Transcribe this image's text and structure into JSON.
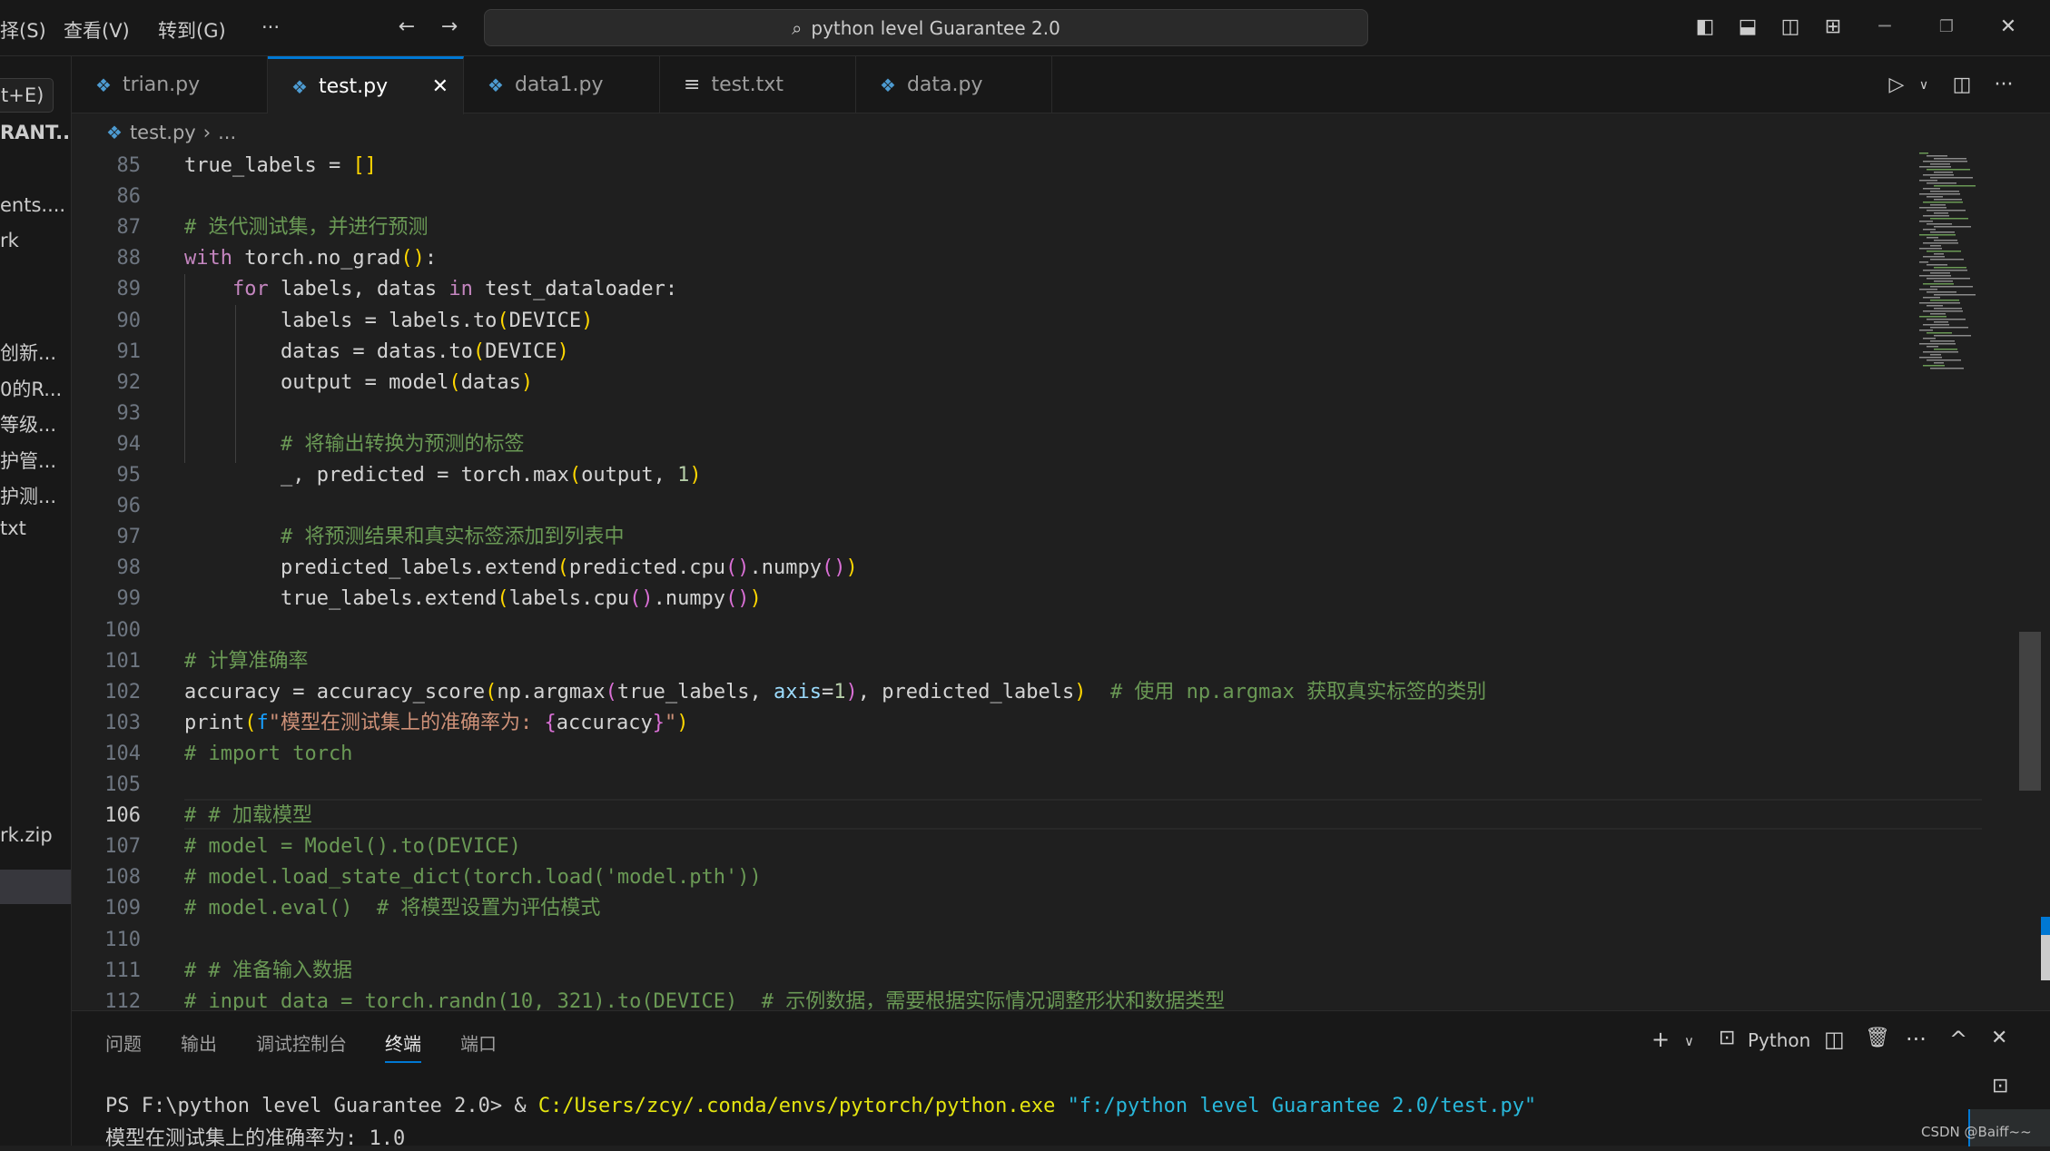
{
  "titlebar": {
    "menus": [
      "择(S)",
      "查看(V)",
      "转到(G)",
      "···"
    ],
    "search_text": "python level Guarantee 2.0",
    "icons": [
      "arrow-left-icon",
      "arrow-right-icon",
      "toggle-sidebar-icon",
      "toggle-panel-icon",
      "toggle-secondary-sidebar-icon",
      "customize-layout-icon",
      "minimize-icon",
      "restore-icon",
      "close-icon"
    ]
  },
  "sidebar": {
    "button_label": "t+E)",
    "header": "RANT...",
    "items": [
      "ents....",
      "rk",
      "创新...",
      "0的R...",
      "等级...",
      "护管...",
      "护测...",
      "txt",
      "rk.zip"
    ]
  },
  "tabs": [
    {
      "label": "trian.py",
      "icon": "python-icon"
    },
    {
      "label": "test.py",
      "icon": "python-icon",
      "active": true
    },
    {
      "label": "data1.py",
      "icon": "python-icon"
    },
    {
      "label": "test.txt",
      "icon": "text-file-icon"
    },
    {
      "label": "data.py",
      "icon": "python-icon"
    }
  ],
  "breadcrumb": {
    "file": "test.py",
    "rest": "..."
  },
  "editor": {
    "current_line": 106,
    "lines": [
      {
        "n": "85",
        "tokens": [
          [
            "true_labels = ",
            "t"
          ],
          [
            "[]",
            "b1"
          ]
        ]
      },
      {
        "n": "86",
        "tokens": []
      },
      {
        "n": "87",
        "tokens": [
          [
            "# 迭代测试集，并进行预测",
            "c"
          ]
        ]
      },
      {
        "n": "88",
        "tokens": [
          [
            "with",
            "k"
          ],
          [
            " torch.no_grad",
            "t"
          ],
          [
            "()",
            "b1"
          ],
          [
            ":",
            "t"
          ]
        ]
      },
      {
        "n": "89",
        "tokens": [
          [
            "    ",
            "t"
          ],
          [
            "for",
            "k"
          ],
          [
            " labels, datas ",
            "t"
          ],
          [
            "in",
            "k"
          ],
          [
            " test_dataloader:",
            "t"
          ]
        ]
      },
      {
        "n": "90",
        "tokens": [
          [
            "        labels = labels.to",
            "t"
          ],
          [
            "(",
            "b1"
          ],
          [
            "DEVICE",
            "t"
          ],
          [
            ")",
            "b1"
          ]
        ]
      },
      {
        "n": "91",
        "tokens": [
          [
            "        datas = datas.to",
            "t"
          ],
          [
            "(",
            "b1"
          ],
          [
            "DEVICE",
            "t"
          ],
          [
            ")",
            "b1"
          ]
        ]
      },
      {
        "n": "92",
        "tokens": [
          [
            "        output = model",
            "t"
          ],
          [
            "(",
            "b1"
          ],
          [
            "datas",
            "t"
          ],
          [
            ")",
            "b1"
          ]
        ]
      },
      {
        "n": "93",
        "tokens": []
      },
      {
        "n": "94",
        "tokens": [
          [
            "        # 将输出转换为预测的标签",
            "c"
          ]
        ]
      },
      {
        "n": "95",
        "tokens": [
          [
            "        _, predicted = torch.max",
            "t"
          ],
          [
            "(",
            "b1"
          ],
          [
            "output, ",
            "t"
          ],
          [
            "1",
            "n"
          ],
          [
            ")",
            "b1"
          ]
        ]
      },
      {
        "n": "96",
        "tokens": []
      },
      {
        "n": "97",
        "tokens": [
          [
            "        # 将预测结果和真实标签添加到列表中",
            "c"
          ]
        ]
      },
      {
        "n": "98",
        "tokens": [
          [
            "        predicted_labels.extend",
            "t"
          ],
          [
            "(",
            "b1"
          ],
          [
            "predicted.cpu",
            "t"
          ],
          [
            "()",
            "b2"
          ],
          [
            ".numpy",
            "t"
          ],
          [
            "()",
            "b2"
          ],
          [
            ")",
            "b1"
          ]
        ]
      },
      {
        "n": "99",
        "tokens": [
          [
            "        true_labels.extend",
            "t"
          ],
          [
            "(",
            "b1"
          ],
          [
            "labels.cpu",
            "t"
          ],
          [
            "()",
            "b2"
          ],
          [
            ".numpy",
            "t"
          ],
          [
            "()",
            "b2"
          ],
          [
            ")",
            "b1"
          ]
        ]
      },
      {
        "n": "100",
        "tokens": []
      },
      {
        "n": "101",
        "tokens": [
          [
            "# 计算准确率",
            "c"
          ]
        ]
      },
      {
        "n": "102",
        "tokens": [
          [
            "accuracy = accuracy_score",
            "t"
          ],
          [
            "(",
            "b1"
          ],
          [
            "np.argmax",
            "t"
          ],
          [
            "(",
            "b2"
          ],
          [
            "true_labels, ",
            "t"
          ],
          [
            "axis",
            "p"
          ],
          [
            "=",
            "t"
          ],
          [
            "1",
            "n"
          ],
          [
            ")",
            "b2"
          ],
          [
            ", predicted_labels",
            "t"
          ],
          [
            ")",
            "b1"
          ],
          [
            "  # 使用 np.argmax 获取真实标签的类别",
            "c"
          ]
        ]
      },
      {
        "n": "103",
        "tokens": [
          [
            "print",
            "t"
          ],
          [
            "(",
            "b1"
          ],
          [
            "f",
            "b3"
          ],
          [
            "\"模型在测试集上的准确率为: ",
            "s"
          ],
          [
            "{",
            "b2"
          ],
          [
            "accuracy",
            "t"
          ],
          [
            "}",
            "b2"
          ],
          [
            "\"",
            "s"
          ],
          [
            ")",
            "b1"
          ]
        ]
      },
      {
        "n": "104",
        "tokens": [
          [
            "# import torch",
            "c"
          ]
        ]
      },
      {
        "n": "105",
        "tokens": []
      },
      {
        "n": "106",
        "tokens": [
          [
            "# # 加载模型",
            "c"
          ]
        ]
      },
      {
        "n": "107",
        "tokens": [
          [
            "# model = Model().to(DEVICE)",
            "c"
          ]
        ]
      },
      {
        "n": "108",
        "tokens": [
          [
            "# model.load_state_dict(torch.load('model.pth'))",
            "c"
          ]
        ]
      },
      {
        "n": "109",
        "tokens": [
          [
            "# model.eval()  # 将模型设置为评估模式",
            "c"
          ]
        ]
      },
      {
        "n": "110",
        "tokens": []
      },
      {
        "n": "111",
        "tokens": [
          [
            "# # 准备输入数据",
            "c"
          ]
        ]
      },
      {
        "n": "112",
        "tokens": [
          [
            "# input_data = torch.randn(10, 321).to(DEVICE)  # 示例数据，需要根据实际情况调整形状和数据类型",
            "c"
          ]
        ]
      }
    ]
  },
  "panel": {
    "tabs": [
      "问题",
      "输出",
      "调试控制台",
      "终端",
      "端口"
    ],
    "active_tab": "终端",
    "terminal_profile": "Python",
    "terminal": {
      "prompt": "PS F:\\python level Guarantee 2.0> & ",
      "exe": "C:/Users/zcy/.conda/envs/pytorch/python.exe",
      "arg": " \"f:/python level Guarantee 2.0/test.py\"",
      "output": "模型在测试集上的准确率为: 1.0"
    }
  },
  "watermark": "CSDN @Baiff~~",
  "colors": {
    "accent": "#0078d4",
    "keyword": "#c586c0",
    "comment": "#6a9955",
    "string": "#ce9178",
    "bracket1": "#ffd700",
    "bracket2": "#da70d6",
    "exe_path": "#e5e510",
    "arg_string": "#29b8db"
  }
}
